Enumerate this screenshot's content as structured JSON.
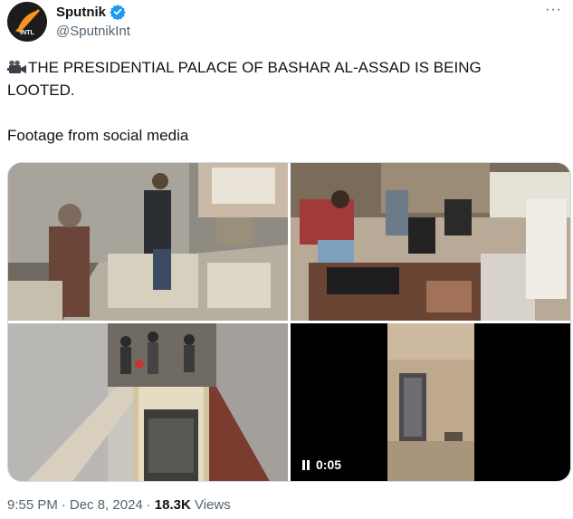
{
  "author": {
    "display_name": "Sputnik",
    "handle": "@SputnikInt",
    "avatar_text": "INTL",
    "verified": true
  },
  "tweet": {
    "line1": "THE PRESIDENTIAL PALACE OF BASHAR AL-ASSAD IS BEING",
    "line2": "LOOTED.",
    "line3": "Footage from social media"
  },
  "media": {
    "video_time": "0:05"
  },
  "meta": {
    "time": "9:55 PM",
    "date": "Dec 8, 2024",
    "separator": "·",
    "views_count": "18.3K",
    "views_label": "Views"
  },
  "icons": {
    "more": "more-dots-icon",
    "verified": "verified-badge-icon",
    "camera": "movie-camera-icon",
    "pause": "pause-icon"
  },
  "colors": {
    "text": "#0f1419",
    "secondary": "#536471",
    "verified_blue": "#1d9bf0",
    "avatar_orange": "#f7931e"
  }
}
